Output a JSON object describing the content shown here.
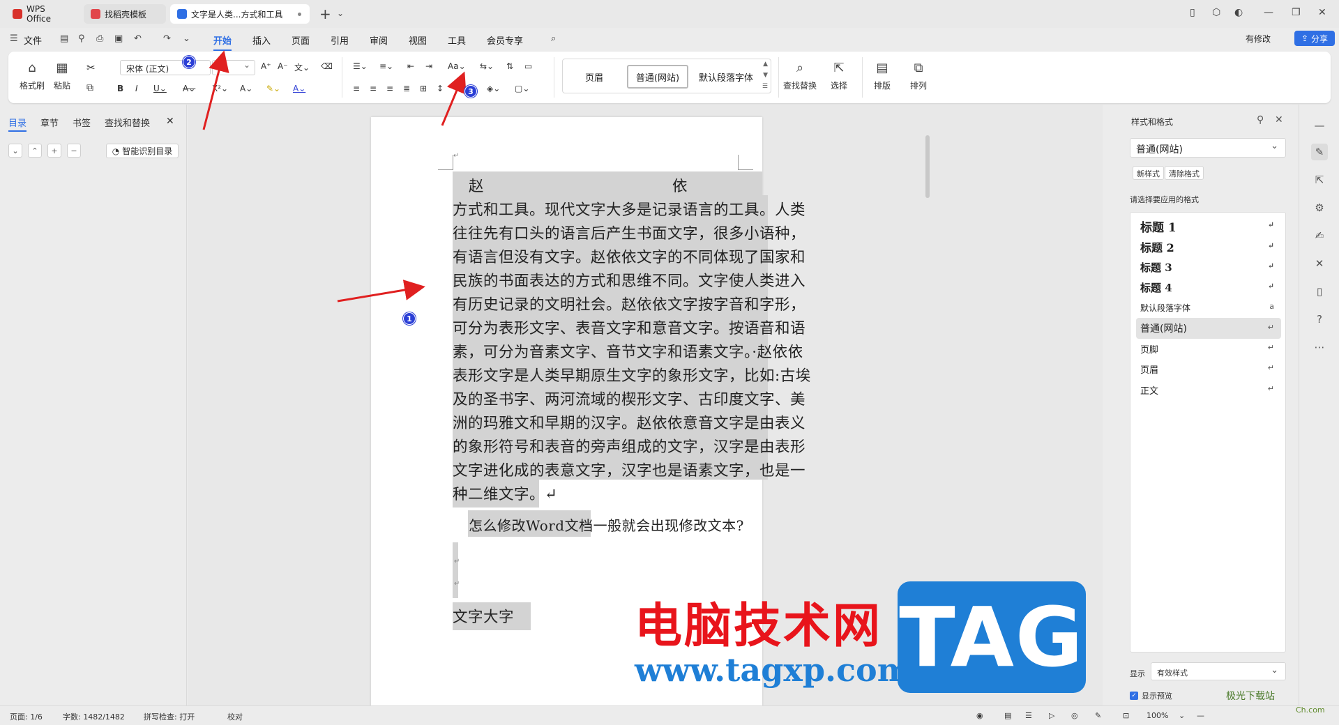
{
  "tabs": [
    {
      "label": "WPS Office",
      "color": "#d8322b"
    },
    {
      "label": "找稻壳模板",
      "color": "#e1464b"
    },
    {
      "label": "文字是人类...方式和工具",
      "color": "#2f6fe4"
    }
  ],
  "menu": {
    "file": "文件",
    "items": [
      "开始",
      "插入",
      "页面",
      "引用",
      "审阅",
      "视图",
      "工具",
      "会员专享"
    ],
    "active": "开始",
    "modify": "有修改",
    "share": "分享"
  },
  "ribbon": {
    "format_painter": "格式刷",
    "paste": "粘贴",
    "font_name": "宋体 (正文)",
    "styles": [
      "页眉",
      "普通(网站)",
      "默认段落字体"
    ],
    "find_replace": "查找替换",
    "select": "选择",
    "typeset": "排版",
    "arrange": "排列"
  },
  "nav": {
    "tabs": [
      "目录",
      "章节",
      "书签",
      "查找和替换"
    ],
    "smart_toc": "智能识别目录"
  },
  "document": {
    "heading_left": "赵",
    "heading_right": "依",
    "lines": [
      "方式和工具。现代文字大多是记录语言的工具。人类",
      "往往先有口头的语言后产生书面文字，很多小语种，",
      "有语言但没有文字。赵依依文字的不同体现了国家和",
      "民族的书面表达的方式和思维不同。文字使人类进入",
      "有历史记录的文明社会。赵依依文字按字音和字形，",
      "可分为表形文字、表音文字和意音文字。按语音和语",
      "素，可分为音素文字、音节文字和语素文字。·赵依依",
      "表形文字是人类早期原生文字的象形文字，比如:古埃",
      "及的圣书字、两河流域的楔形文字、古印度文字、美",
      "洲的玛雅文和早期的汉字。赵依依意音文字是由表义",
      "的象形符号和表音的旁声组成的文字，汉字是由表形",
      "文字进化成的表意文字，汉字也是语素文字，也是一",
      "种二维文字。↵"
    ],
    "question": "怎么修改Word文档一般就会出现修改文本?",
    "next_heading": "文字大字"
  },
  "styles_pane": {
    "title": "样式和格式",
    "current": "普通(网站)",
    "new_style": "新样式",
    "clear_format": "清除格式",
    "hint": "请选择要应用的格式",
    "items": [
      {
        "label": "标题  1",
        "weight": "bold",
        "size": 17,
        "mark": "↵"
      },
      {
        "label": "标题  2",
        "weight": "bold",
        "size": 16,
        "mark": "↵"
      },
      {
        "label": "标题  3",
        "weight": "bold",
        "size": 15,
        "mark": "↵"
      },
      {
        "label": "标题  4",
        "weight": "bold",
        "size": 15,
        "mark": "↵"
      },
      {
        "label": "默认段落字体",
        "weight": "normal",
        "size": 12,
        "mark": "a"
      },
      {
        "label": "普通(网站)",
        "weight": "normal",
        "size": 14,
        "mark": "↵"
      },
      {
        "label": "页脚",
        "weight": "normal",
        "size": 13,
        "mark": "↵"
      },
      {
        "label": "页眉",
        "weight": "normal",
        "size": 13,
        "mark": "↵"
      },
      {
        "label": "正文",
        "weight": "normal",
        "size": 13,
        "mark": "↵"
      }
    ],
    "selected": "普通(网站)",
    "show_label": "显示",
    "show_value": "有效样式",
    "preview_label": "显示预览"
  },
  "status": {
    "page": "页面: 1/6",
    "words": "字数: 1482/1482",
    "spell": "拼写检查: 打开",
    "proof": "校对",
    "zoom": "100%"
  },
  "annotations": [
    "1",
    "2",
    "3"
  ],
  "watermark": {
    "cn": "电脑技术网",
    "url": "www.tagxp.com",
    "tag": "TAG",
    "corner": "极光下载站",
    "corner2": "Ch.com"
  },
  "colors": {
    "accent": "#2f6fe4",
    "selection": "#d3d3d3",
    "arrow": "#e02020",
    "badge": "#2b3fd6"
  }
}
